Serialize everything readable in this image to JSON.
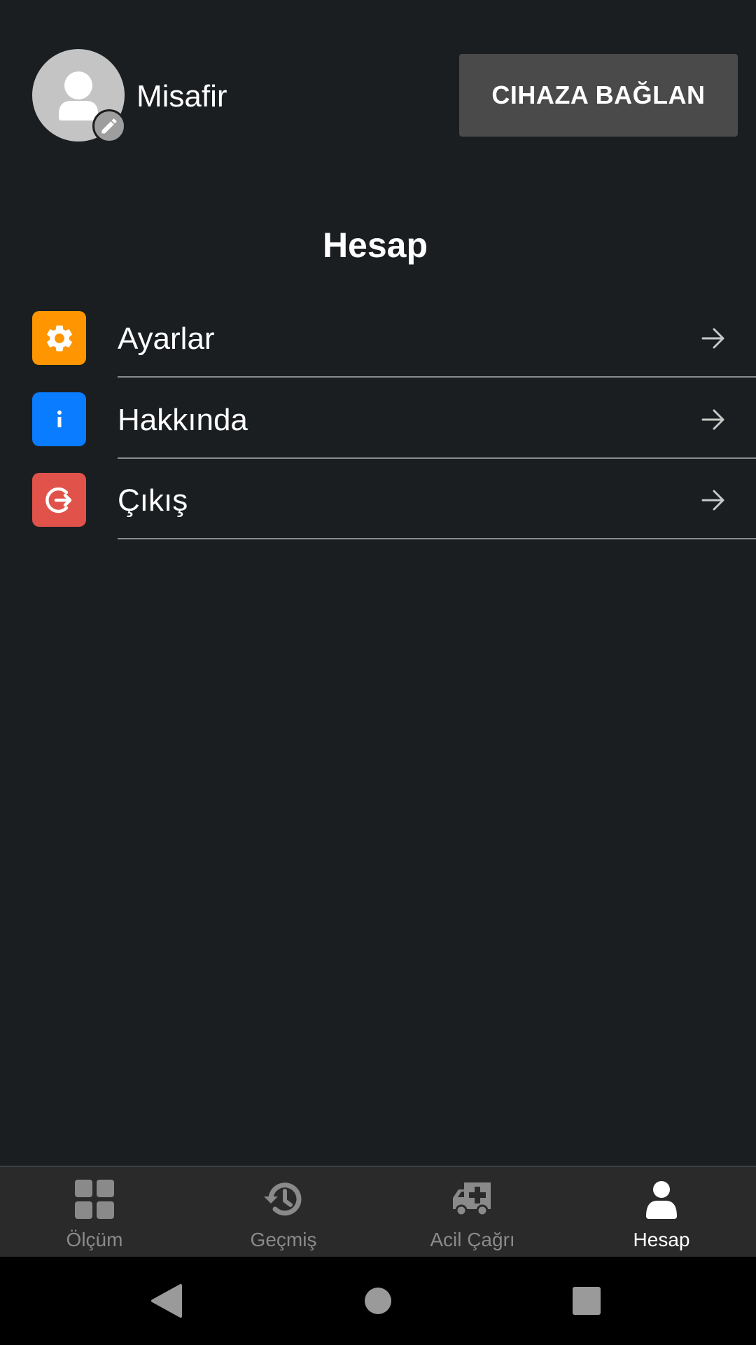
{
  "header": {
    "user_name": "Misafir",
    "connect_button": "CIHAZA BAĞLAN"
  },
  "section": {
    "title": "Hesap"
  },
  "menu": {
    "items": [
      {
        "label": "Ayarlar",
        "icon": "gear-icon",
        "color": "#ff9500"
      },
      {
        "label": "Hakkında",
        "icon": "info-icon",
        "color": "#0a7cff"
      },
      {
        "label": "Çıkış",
        "icon": "logout-icon",
        "color": "#e0524a"
      }
    ]
  },
  "bottom_nav": {
    "items": [
      {
        "label": "Ölçüm",
        "icon": "dashboard-grid-icon",
        "active": false
      },
      {
        "label": "Geçmiş",
        "icon": "history-icon",
        "active": false
      },
      {
        "label": "Acil Çağrı",
        "icon": "ambulance-icon",
        "active": false
      },
      {
        "label": "Hesap",
        "icon": "user-icon",
        "active": true
      }
    ]
  },
  "colors": {
    "background": "#1b1e21",
    "nav_background": "#2a2a2a",
    "button_background": "#4a4a4a",
    "inactive": "#8a8a8a",
    "active": "#ffffff"
  }
}
